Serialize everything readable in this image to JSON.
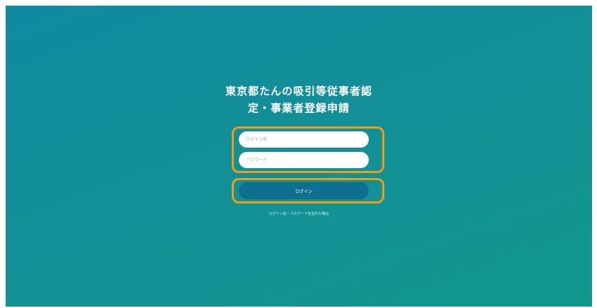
{
  "page": {
    "title_line1": "東京都たんの吸引等従事者認",
    "title_line2": "定・事業者登録申請"
  },
  "form": {
    "login_name_placeholder": "ログイン名",
    "password_placeholder": "パスワード",
    "login_button_label": "ログイン",
    "forgot_link_label": "ログイン名・パスワードを忘れた場合"
  },
  "colors": {
    "highlight": "#f39c12",
    "button": "#0f6f8e"
  }
}
